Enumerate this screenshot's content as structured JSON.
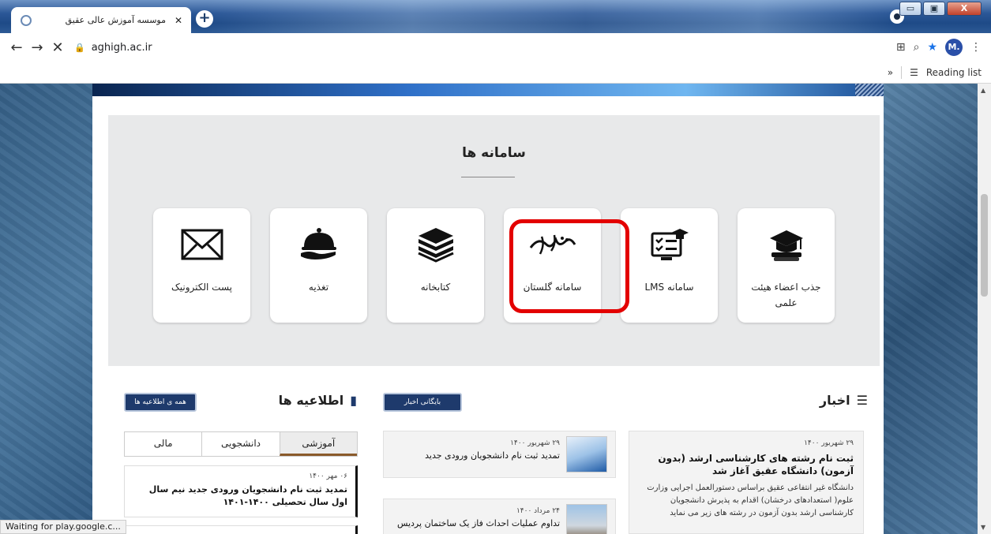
{
  "browser": {
    "tab_title": "موسسه آموزش عالی عقیق",
    "tab_close": "✕",
    "new_tab": "+",
    "url": "aghigh.ac.ir",
    "profile_initial": "M.",
    "reading_list": "Reading list",
    "more_bookmarks": "»",
    "back": "←",
    "forward": "→",
    "stop": "✕",
    "menu": "⋮",
    "window_min": "▭",
    "window_max": "▣",
    "window_close": "X",
    "status_text": "Waiting for play.google.c..."
  },
  "systems": {
    "heading": "سامانه ها",
    "cards": [
      {
        "label": "جذب اعضاء هیئت علمی",
        "icon": "graduation-cap-icon"
      },
      {
        "label": "سامانه LMS",
        "icon": "checklist-board-icon"
      },
      {
        "label": "سامانه گلستان",
        "icon": "golestan-logo-icon"
      },
      {
        "label": "کتابخانه",
        "icon": "books-stack-icon"
      },
      {
        "label": "تغذیه",
        "icon": "food-cloche-icon"
      },
      {
        "label": "پست الکترونیک",
        "icon": "envelope-icon"
      }
    ],
    "highlight_color": "#e30000"
  },
  "news": {
    "heading": "اخبار",
    "archive_button": "بایگانی اخبار",
    "main": {
      "date": "۲۹ شهریور ۱۴۰۰",
      "title": "ثبت نام رشته های کارشناسی ارشد (بدون آزمون) دانشگاه عقیق آغاز شد",
      "description": "دانشگاه غیر انتفاعی عقیق براساس دستورالعمل اجرایی وزارت علوم( استعدادهای درخشان) اقدام به پذیرش دانشجویان کارشناسی ارشد بدون آزمون در رشته های زیر می نماید"
    },
    "items": [
      {
        "date": "۲۹ شهریور ۱۴۰۰",
        "title": "تمدید ثبت نام دانشجویان ورودی جدید"
      },
      {
        "date": "۲۴ مرداد ۱۴۰۰",
        "title": "تداوم عملیات احداث فاز یک ساختمان پردیس"
      }
    ]
  },
  "announcements": {
    "heading": "اطلاعیه ها",
    "all_button": "همه ی اطلاعیه ها",
    "tabs": [
      "آموزشی",
      "دانشجویی",
      "مالی"
    ],
    "items": [
      {
        "date": "۰۶ مهر ۱۴۰۰",
        "title": "تمدید ثبت نام دانشجویان ورودی جدید نیم سال اول سال تحصیلی ۱۴۰۰-۱۴۰۱"
      }
    ]
  },
  "colors": {
    "accent": "#1e3a6c",
    "highlight": "#e30000"
  }
}
